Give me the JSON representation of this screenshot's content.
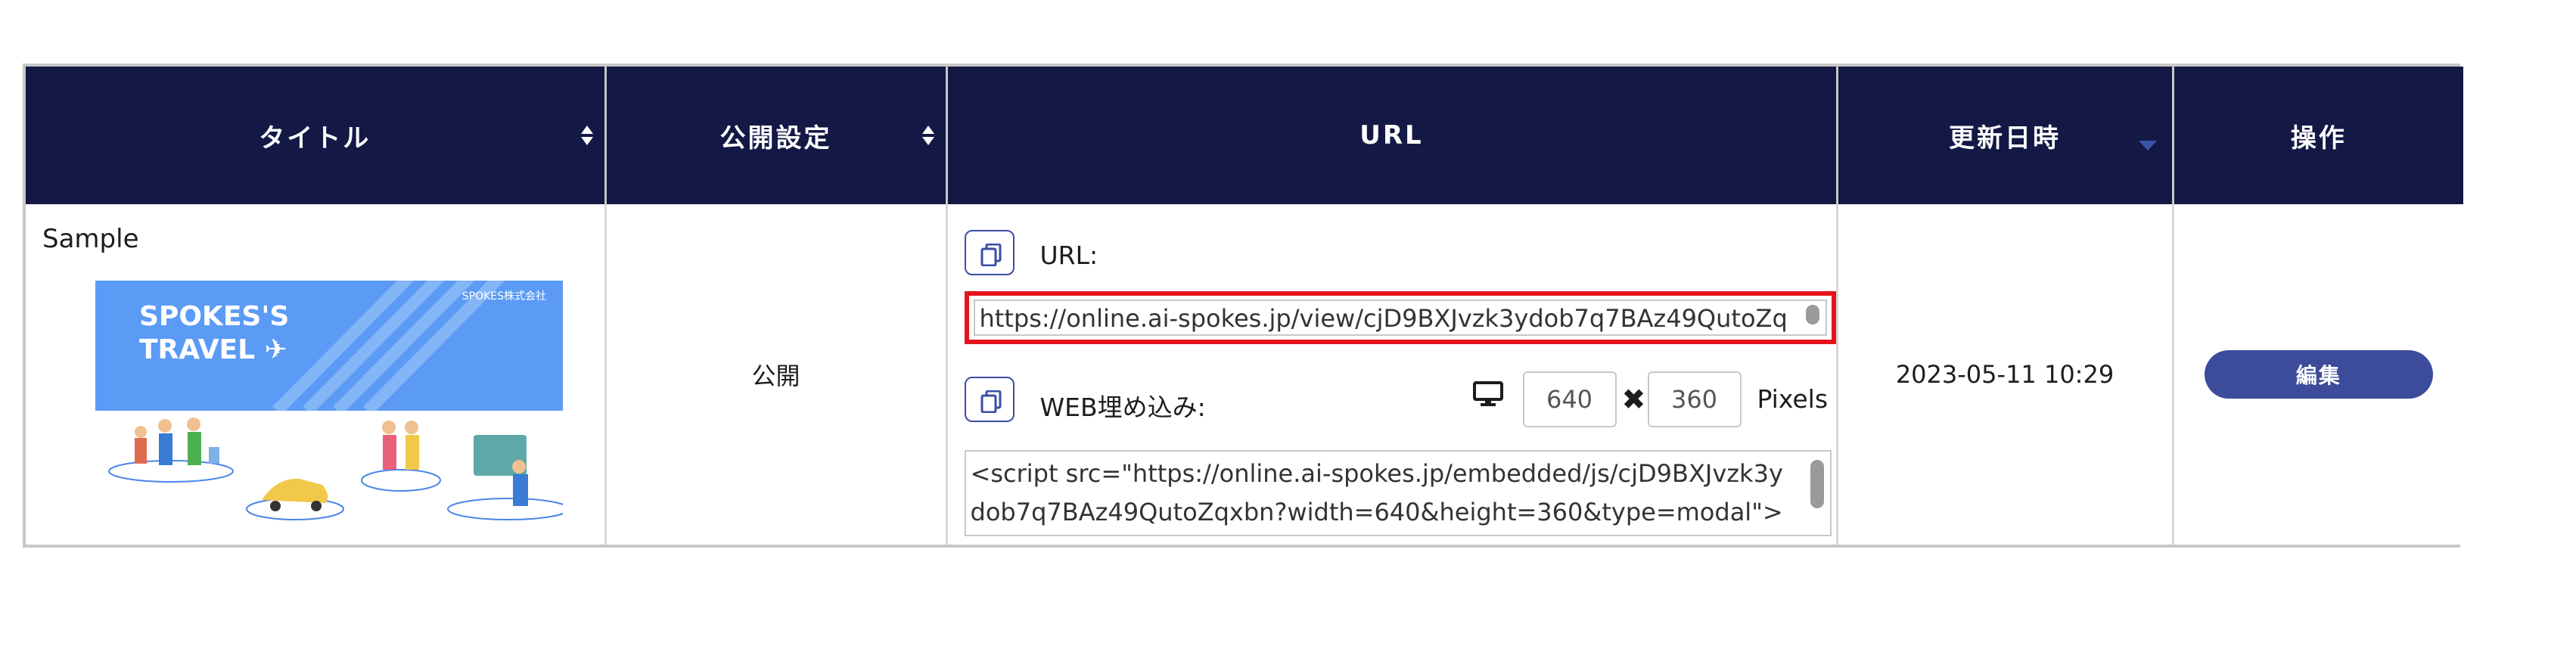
{
  "table": {
    "headers": {
      "title": "タイトル",
      "public": "公開設定",
      "url": "URL",
      "updated": "更新日時",
      "action": "操作"
    },
    "row": {
      "title": "Sample",
      "thumbnail": {
        "company": "SPOKES株式会社",
        "banner_line1": "SPOKES'S",
        "banner_line2": "TRAVEL",
        "banner_color": "#5b9bf5"
      },
      "public_status": "公開",
      "url_label": "URL:",
      "url_value": "https://online.ai-spokes.jp/view/cjD9BXJvzk3ydob7q7BAz49QutoZq",
      "embed_label": "WEB埋め込み:",
      "embed_code": "<script src=\"https://online.ai-spokes.jp/embedded/js/cjD9BXJvzk3ydob7q7BAz49QutoZqxbn?width=640&height=360&type=modal\"></",
      "width": "640",
      "height": "360",
      "times": "✖",
      "pixels_label": "Pixels",
      "updated": "2023-05-11 10:29",
      "edit_label": "編集"
    }
  },
  "colors": {
    "header_bg": "#131845",
    "highlight_border": "#e4141d",
    "button": "#3c4b9a"
  },
  "icons": {
    "copy": "copy-icon",
    "monitor": "monitor-icon",
    "sort": "sort-icon"
  }
}
